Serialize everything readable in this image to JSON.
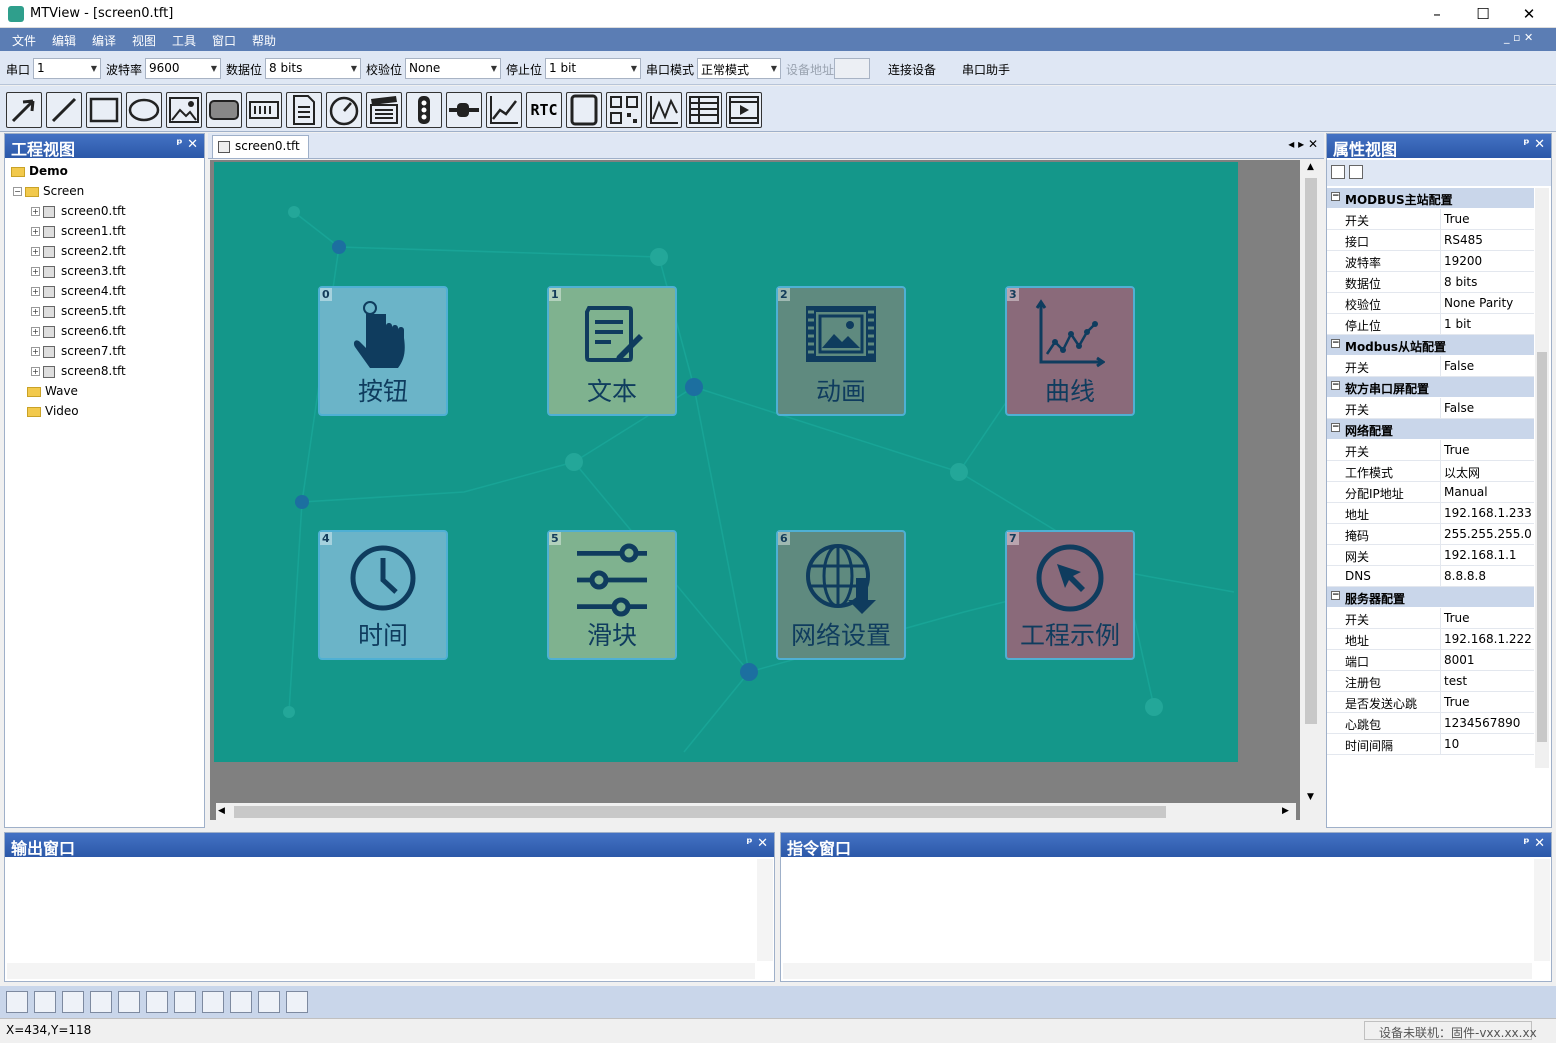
{
  "window": {
    "title": "MTView - [screen0.tft]",
    "minimize": "–",
    "maximize": "☐",
    "close": "✕"
  },
  "menu": [
    "文件",
    "编辑",
    "编译",
    "视图",
    "工具",
    "窗口",
    "帮助"
  ],
  "mdi_controls": "_ ▫ ✕",
  "serial": {
    "port_label": "串口",
    "port_value": "1",
    "baud_label": "波特率",
    "baud_value": "9600",
    "databits_label": "数据位",
    "databits_value": "8 bits",
    "parity_label": "校验位",
    "parity_value": "None",
    "stopbits_label": "停止位",
    "stopbits_value": "1 bit",
    "mode_label": "串口模式",
    "mode_value": "正常模式",
    "address_label": "设备地址",
    "connect": "连接设备",
    "assistant": "串口助手"
  },
  "toolbar_icons": [
    "arrow-tool-icon",
    "line-tool-icon",
    "rect-tool-icon",
    "ellipse-tool-icon",
    "image-tool-icon",
    "button-tool-icon",
    "text-tool-icon",
    "document-tool-icon",
    "gauge-tool-icon",
    "animation-tool-icon",
    "progress-tool-icon",
    "slider-tool-icon",
    "curve-tool-icon",
    "rtc-tool-icon",
    "frame-tool-icon",
    "qrcode-tool-icon",
    "wave-tool-icon",
    "table-tool-icon",
    "video-tool-icon"
  ],
  "rtc_label": "RTC",
  "project": {
    "title": "工程视图",
    "root": "Demo",
    "screen_folder": "Screen",
    "files": [
      "screen0.tft",
      "screen1.tft",
      "screen2.tft",
      "screen3.tft",
      "screen4.tft",
      "screen5.tft",
      "screen6.tft",
      "screen7.tft",
      "screen8.tft"
    ],
    "folders": [
      "Wave",
      "Video"
    ]
  },
  "panel_ctrl": "ᵖ ✕",
  "editor": {
    "tab": "screen0.tft",
    "tab_nav": "◂ ▸ ✕"
  },
  "tiles": [
    {
      "num": "0",
      "label": "按钮",
      "color": "#6bb4c8",
      "icon": "hand-touch-icon"
    },
    {
      "num": "1",
      "label": "文本",
      "color": "#7fb28f",
      "icon": "text-edit-icon"
    },
    {
      "num": "2",
      "label": "动画",
      "color": "#5f8a7f",
      "icon": "picture-frame-icon"
    },
    {
      "num": "3",
      "label": "曲线",
      "color": "#8a6a7a",
      "icon": "line-chart-icon"
    },
    {
      "num": "4",
      "label": "时间",
      "color": "#6bb4c8",
      "icon": "clock-icon"
    },
    {
      "num": "5",
      "label": "滑块",
      "color": "#7fb28f",
      "icon": "slider-icon"
    },
    {
      "num": "6",
      "label": "网络设置",
      "color": "#5f8a7f",
      "icon": "globe-download-icon"
    },
    {
      "num": "7",
      "label": "工程示例",
      "color": "#8a6a7a",
      "icon": "cursor-circle-icon"
    }
  ],
  "properties": {
    "title": "属性视图",
    "groups": [
      {
        "name": "MODBUS主站配置",
        "rows": [
          [
            "开关",
            "True"
          ],
          [
            "接口",
            "RS485"
          ],
          [
            "波特率",
            "19200"
          ],
          [
            "数据位",
            "8 bits"
          ],
          [
            "校验位",
            "None Parity"
          ],
          [
            "停止位",
            "1 bit"
          ]
        ]
      },
      {
        "name": "Modbus从站配置",
        "rows": [
          [
            "开关",
            "False"
          ]
        ]
      },
      {
        "name": "软方串口屏配置",
        "rows": [
          [
            "开关",
            "False"
          ]
        ]
      },
      {
        "name": "网络配置",
        "rows": [
          [
            "开关",
            "True"
          ],
          [
            "工作模式",
            "以太网"
          ],
          [
            "分配IP地址",
            "Manual"
          ],
          [
            "地址",
            "192.168.1.233"
          ],
          [
            "掩码",
            "255.255.255.0"
          ],
          [
            "网关",
            "192.168.1.1"
          ],
          [
            "DNS",
            "8.8.8.8"
          ]
        ]
      },
      {
        "name": "服务器配置",
        "rows": [
          [
            "开关",
            "True"
          ],
          [
            "地址",
            "192.168.1.222"
          ],
          [
            "端口",
            "8001"
          ],
          [
            "注册包",
            "test"
          ],
          [
            "是否发送心跳",
            "True"
          ],
          [
            "心跳包",
            "1234567890"
          ],
          [
            "时间间隔",
            "10"
          ]
        ]
      }
    ]
  },
  "output": {
    "title": "输出窗口"
  },
  "command": {
    "title": "指令窗口"
  },
  "status": {
    "coords": "X=434,Y=118",
    "device": "设备未联机：固件-vxx.xx.xx"
  }
}
